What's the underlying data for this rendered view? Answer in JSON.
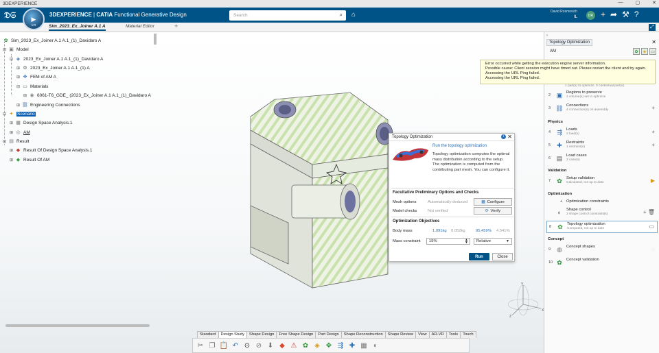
{
  "window": {
    "title": "3DEXPERIENCE"
  },
  "topbar": {
    "brand_bold": "3DEXPERIENCE",
    "brand_sep": " | ",
    "brand_app": "CATIA",
    "brand_suffix": " Functional Generative Design",
    "compass_version": "V.R",
    "search_placeholder": "Search",
    "user_name": "David Rosmovich",
    "user_org": "IL",
    "avatar_initials": "DR"
  },
  "tabs": [
    {
      "label": "Sim_2023_Ex_Joiner A.1 A"
    },
    {
      "label": "Material Editor"
    },
    {
      "label": "+"
    }
  ],
  "tree": [
    {
      "label": "Sim_2023_Ex_Joiner A.1 A.1_(1)_Davidaro A",
      "icon": "sim-root-icon"
    },
    {
      "label": "Model",
      "icon": "model-icon"
    },
    {
      "label": "2023_Ex_Joiner A.1 A.1_(1)_Davidaro A",
      "icon": "product-icon"
    },
    {
      "label": "2023_Ex_Joiner A.1 A.1_(1) A",
      "icon": "part-icon"
    },
    {
      "label": "FEM of AM A",
      "icon": "fem-icon"
    },
    {
      "label": "Materials",
      "icon": "folder-icon"
    },
    {
      "label": "6061-T6_GDE_ (2023_Ex_Joiner A.1 A.1_(1)_Davidaro A",
      "icon": "material-icon"
    },
    {
      "label": "Engineering Connections",
      "icon": "connections-icon"
    },
    {
      "label": "Scenario",
      "icon": "scenario-icon"
    },
    {
      "label": "Design Space Analysis.1",
      "icon": "analysis-icon"
    },
    {
      "label": "AM",
      "icon": "am-icon"
    },
    {
      "label": "Result",
      "icon": "result-icon"
    },
    {
      "label": "Result Of Design Space Analysis.1",
      "icon": "result-item-icon"
    },
    {
      "label": "Result Of AM",
      "icon": "result-item-icon"
    }
  ],
  "dialog": {
    "title": "Topology Optimization",
    "link": "Run the topology optimization",
    "desc1": "Topology optimization computes the optimal mass distribution according to the setup.",
    "desc2": "The optimization is computed from the contributing part mesh. You can configure it.",
    "section1": "Facultative Preliminary Options and Checks",
    "mesh_label": "Mesh options",
    "mesh_value": "Automatically deduced",
    "mesh_button": "Configure",
    "model_label": "Model checks",
    "model_value": "Not verified",
    "model_button": "Verify",
    "section2": "Optimization Objectives",
    "body_label": "Body mass",
    "body_v1": "1.091kg",
    "body_v2": "0.052kg",
    "body_v3": "95.459%",
    "body_v4": "4.541%",
    "mass_label": "Mass constraint",
    "mass_value": "15%",
    "mass_mode": "Relative",
    "run": "Run",
    "close": "Close"
  },
  "toolbar_tabs": [
    "Standard",
    "Design Study",
    "Shape Design",
    "Free Shape Design",
    "Part Design",
    "Shape Reconstruction",
    "Shape Review",
    "View",
    "AR-VR",
    "Tools",
    "Touch"
  ],
  "right_panel": {
    "title": "Topology Optimization",
    "sub": "AM",
    "error_lines": [
      "Error occurred while getting the execution engine server information.",
      "Possible cause: Client session might have timed out. Please restart the client and try again.",
      "Accessing the URL Ping failed.",
      "Accessing the URL Ping failed."
    ],
    "partial_sub": "1 part(s) to optimize, 0 contextual part(s)",
    "sections": {
      "physics": "Physics",
      "validation": "Validation",
      "optimization": "Optimization",
      "concept": "Concept"
    },
    "items": [
      {
        "num": "2",
        "name": "Regions to preserve",
        "sub": "1 volume(s) set to optimize"
      },
      {
        "num": "3",
        "name": "Connections",
        "sub": "4 connection(s) on assembly"
      },
      {
        "num": "4",
        "name": "Loads",
        "sub": "2 load(s)"
      },
      {
        "num": "5",
        "name": "Restraints",
        "sub": "1 restraint(s)"
      },
      {
        "num": "6",
        "name": "Load cases",
        "sub": "2 case(s)"
      },
      {
        "num": "7",
        "name": "Setup validation",
        "sub": "Calculated, not up to date"
      },
      {
        "num": "",
        "name": "Optimization constraints",
        "sub": ""
      },
      {
        "num": "",
        "name": "Shape control",
        "sub": "2 shape control constraint(s)"
      },
      {
        "num": "8",
        "name": "Topology optimization",
        "sub": "Computed, not up to date"
      },
      {
        "num": "9",
        "name": "Concept shapes",
        "sub": ""
      },
      {
        "num": "10",
        "name": "Concept validation",
        "sub": ""
      }
    ]
  },
  "colors": {
    "brand": "#005386",
    "accent": "#2a6fb5",
    "warning": "#e07f1f",
    "part_green": "#cfe7b0"
  }
}
